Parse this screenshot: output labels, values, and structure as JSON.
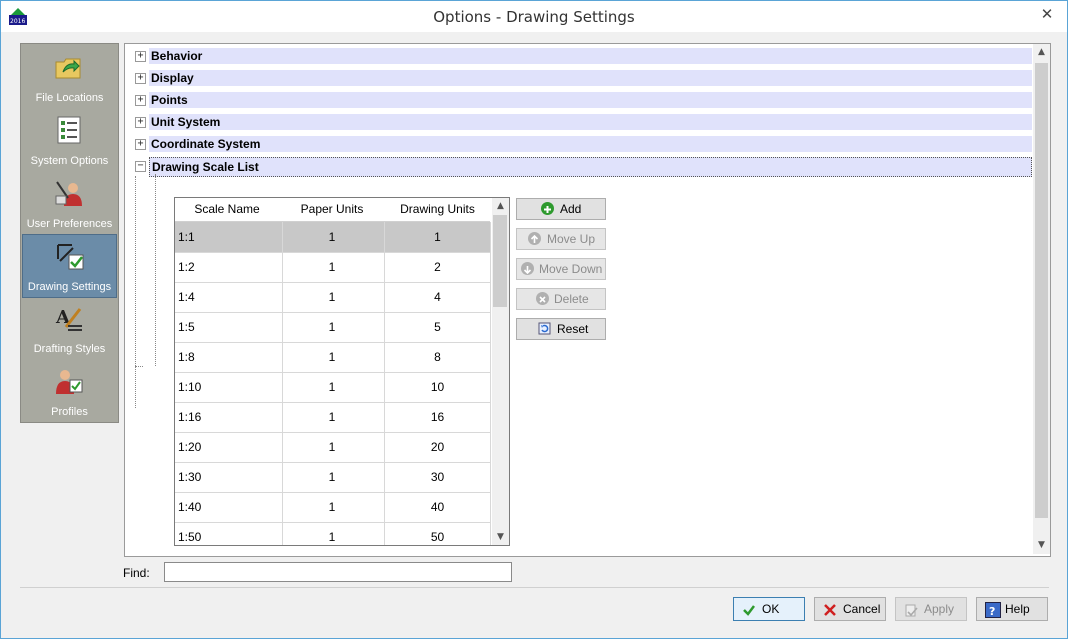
{
  "window": {
    "title": "Options - Drawing Settings",
    "close": "✕",
    "app_icon_text": "2016"
  },
  "sidebar": {
    "items": [
      {
        "label": "File Locations",
        "icon": "folder-arrow-icon"
      },
      {
        "label": "System Options",
        "icon": "checklist-icon"
      },
      {
        "label": "User Preferences",
        "icon": "user-tools-icon"
      },
      {
        "label": "Drawing Settings",
        "icon": "drawing-check-icon",
        "active": true
      },
      {
        "label": "Drafting Styles",
        "icon": "pen-style-icon"
      },
      {
        "label": "Profiles",
        "icon": "profile-icon"
      }
    ]
  },
  "categories": [
    {
      "label": "Behavior",
      "state": "+"
    },
    {
      "label": "Display",
      "state": "+"
    },
    {
      "label": "Points",
      "state": "+"
    },
    {
      "label": "Unit System",
      "state": "+"
    },
    {
      "label": "Coordinate System",
      "state": "+"
    },
    {
      "label": "Drawing Scale List",
      "state": "−"
    }
  ],
  "grid": {
    "headers": [
      "Scale Name",
      "Paper Units",
      "Drawing Units"
    ],
    "rows": [
      [
        "1:1",
        "1",
        "1"
      ],
      [
        "1:2",
        "1",
        "2"
      ],
      [
        "1:4",
        "1",
        "4"
      ],
      [
        "1:5",
        "1",
        "5"
      ],
      [
        "1:8",
        "1",
        "8"
      ],
      [
        "1:10",
        "1",
        "10"
      ],
      [
        "1:16",
        "1",
        "16"
      ],
      [
        "1:20",
        "1",
        "20"
      ],
      [
        "1:30",
        "1",
        "30"
      ],
      [
        "1:40",
        "1",
        "40"
      ],
      [
        "1:50",
        "1",
        "50"
      ]
    ],
    "selected_row": 0
  },
  "actions": {
    "add": "Add",
    "move_up": "Move Up",
    "move_down": "Move Down",
    "delete": "Delete",
    "reset": "Reset"
  },
  "find": {
    "label": "Find:",
    "value": ""
  },
  "dialog": {
    "ok": "OK",
    "cancel": "Cancel",
    "apply": "Apply",
    "help": "Help"
  },
  "colors": {
    "sidebar_bg": "#a8a9a0",
    "sidebar_active": "#6b8ca8",
    "category_bg": "#e0e2fb",
    "selected_row": "#c8c8c8",
    "add_green": "#2e9a2e"
  }
}
